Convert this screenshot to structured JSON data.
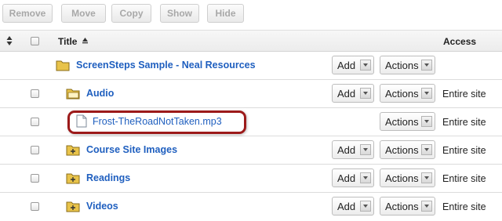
{
  "toolbar": {
    "buttons": [
      "Remove",
      "Move",
      "Copy",
      "Show",
      "Hide"
    ]
  },
  "header": {
    "title": "Title",
    "access": "Access"
  },
  "rows": [
    {
      "name": "ScreenSteps Sample - Neal Resources",
      "add": "Add",
      "actions": "Actions",
      "access": ""
    },
    {
      "name": "Audio",
      "add": "Add",
      "actions": "Actions",
      "access": "Entire site"
    },
    {
      "name": "Frost-TheRoadNotTaken.mp3",
      "add": "",
      "actions": "Actions",
      "access": "Entire site"
    },
    {
      "name": "Course Site Images",
      "add": "Add",
      "actions": "Actions",
      "access": "Entire site"
    },
    {
      "name": "Readings",
      "add": "Add",
      "actions": "Actions",
      "access": "Entire site"
    },
    {
      "name": "Videos",
      "add": "Add",
      "actions": "Actions",
      "access": "Entire site"
    }
  ],
  "colors": {
    "link": "#1f5fbf",
    "highlight": "#9c1a1a",
    "folder": "#e8c34a"
  },
  "icons": {
    "folder": "folder-icon",
    "open_folder": "folder-open-icon",
    "folder_plus": "folder-plus-icon",
    "file": "file-icon",
    "sort": "sort-icon",
    "sort_up": "sort-ascending-icon",
    "dropdown": "dropdown-arrow-icon"
  }
}
